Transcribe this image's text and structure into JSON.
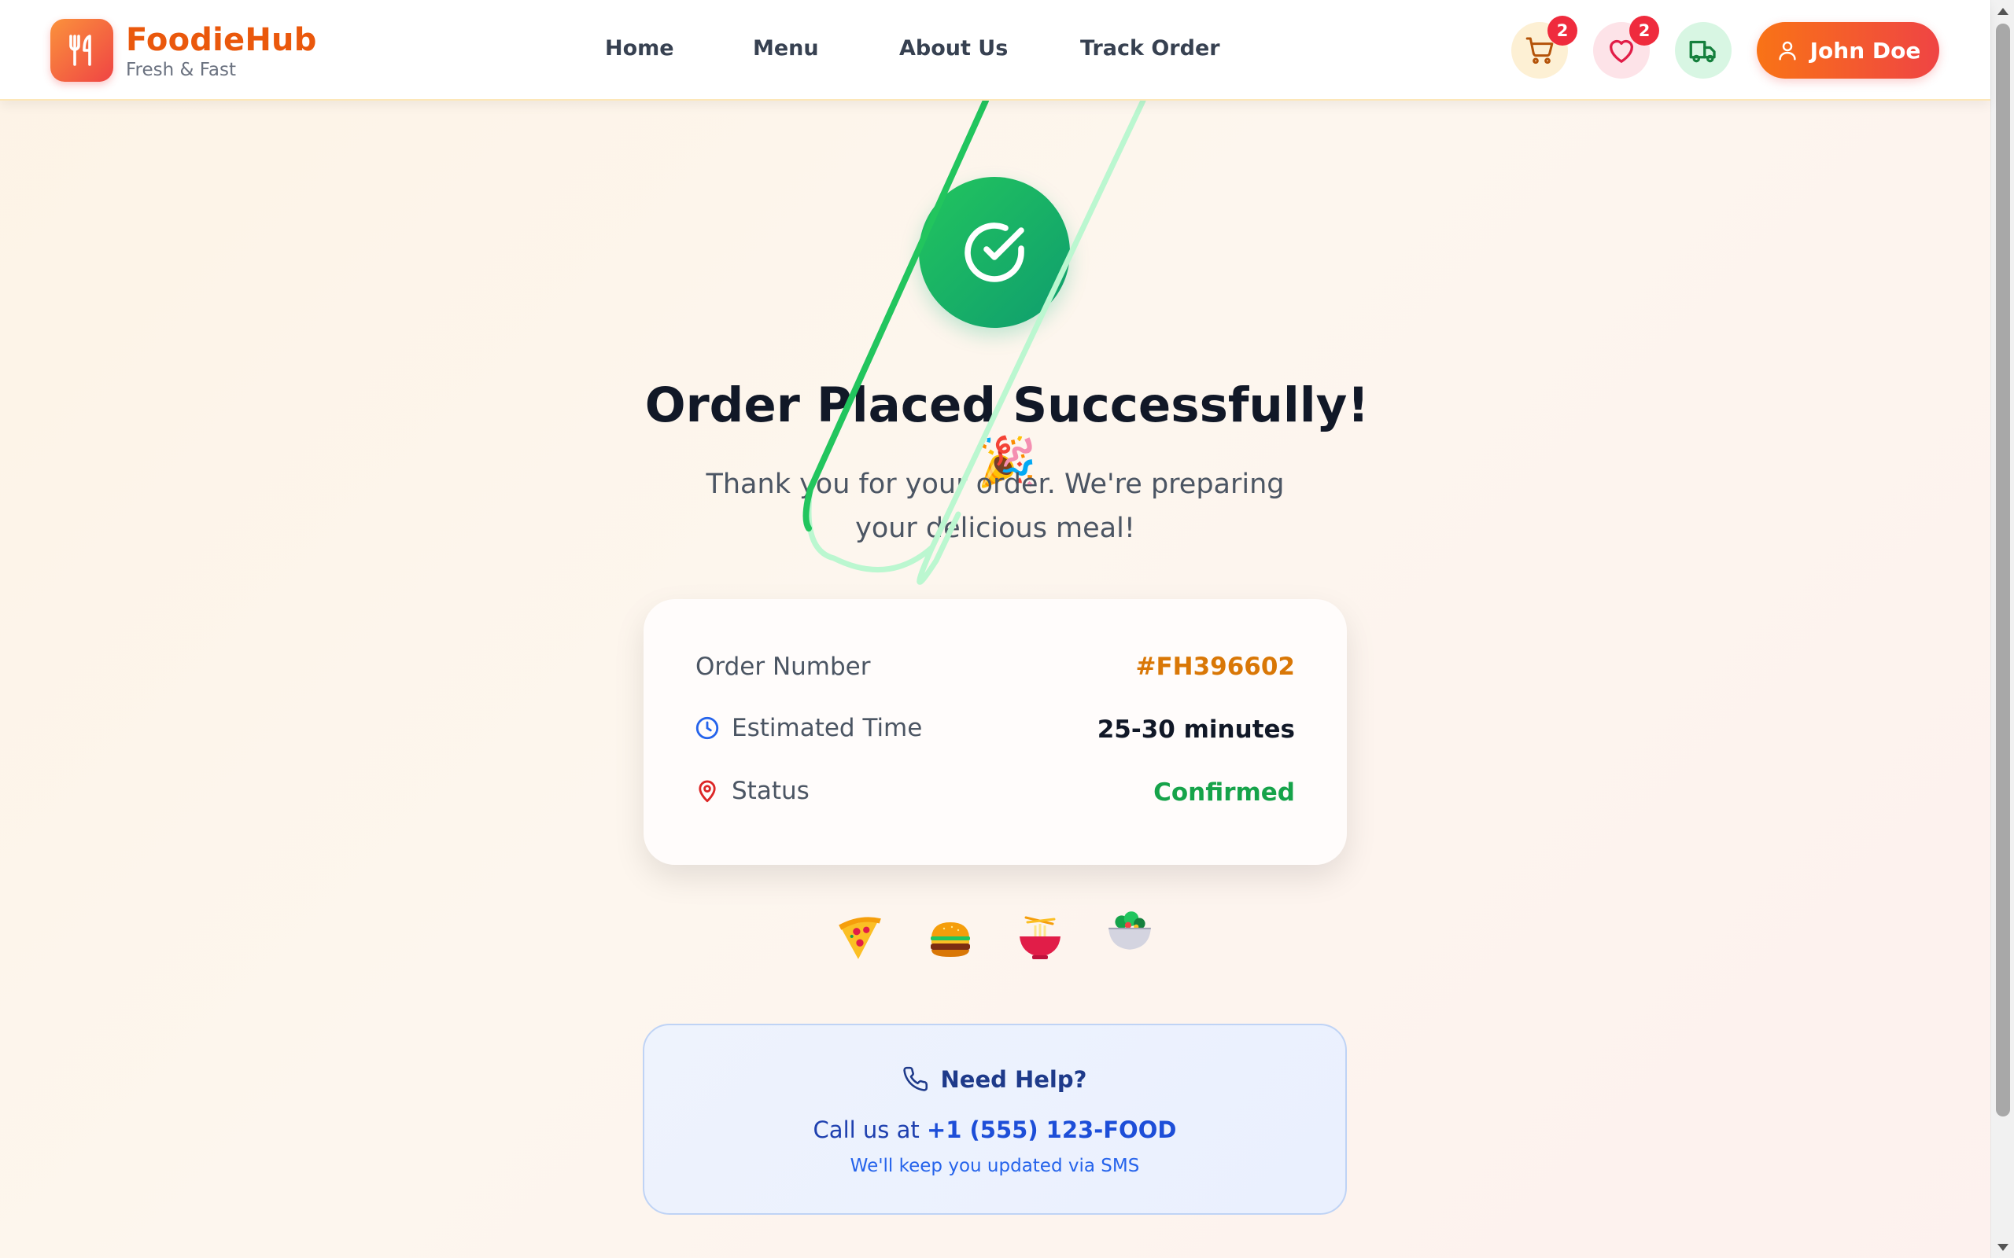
{
  "header": {
    "brand": {
      "name": "FoodieHub",
      "tagline": "Fresh & Fast"
    },
    "nav": [
      {
        "label": "Home"
      },
      {
        "label": "Menu"
      },
      {
        "label": "About Us"
      },
      {
        "label": "Track Order"
      }
    ],
    "cart_count": "2",
    "favorites_count": "2",
    "user_name": "John Doe"
  },
  "confirmation": {
    "title": "Order Placed Successfully!",
    "title_emoji": "🎉",
    "subtitle": "Thank you for your order. We're preparing your delicious meal!"
  },
  "order": {
    "number_label": "Order Number",
    "number_value": "#FH396602",
    "time_label": "Estimated Time",
    "time_value": "25-30 minutes",
    "status_label": "Status",
    "status_value": "Confirmed"
  },
  "food_icons": [
    "pizza-icon",
    "burger-icon",
    "noodles-icon",
    "salad-icon"
  ],
  "help": {
    "title": "Need Help?",
    "call_prefix": "Call us at",
    "phone": "+1 (555) 123-FOOD",
    "sms_note": "We'll keep you updated via SMS"
  },
  "colors": {
    "brand_orange": "#ea580c",
    "order_number": "#d97706",
    "status_green": "#16a34a",
    "success_green": "#22c55e",
    "badge_red": "#ef2b3d"
  }
}
